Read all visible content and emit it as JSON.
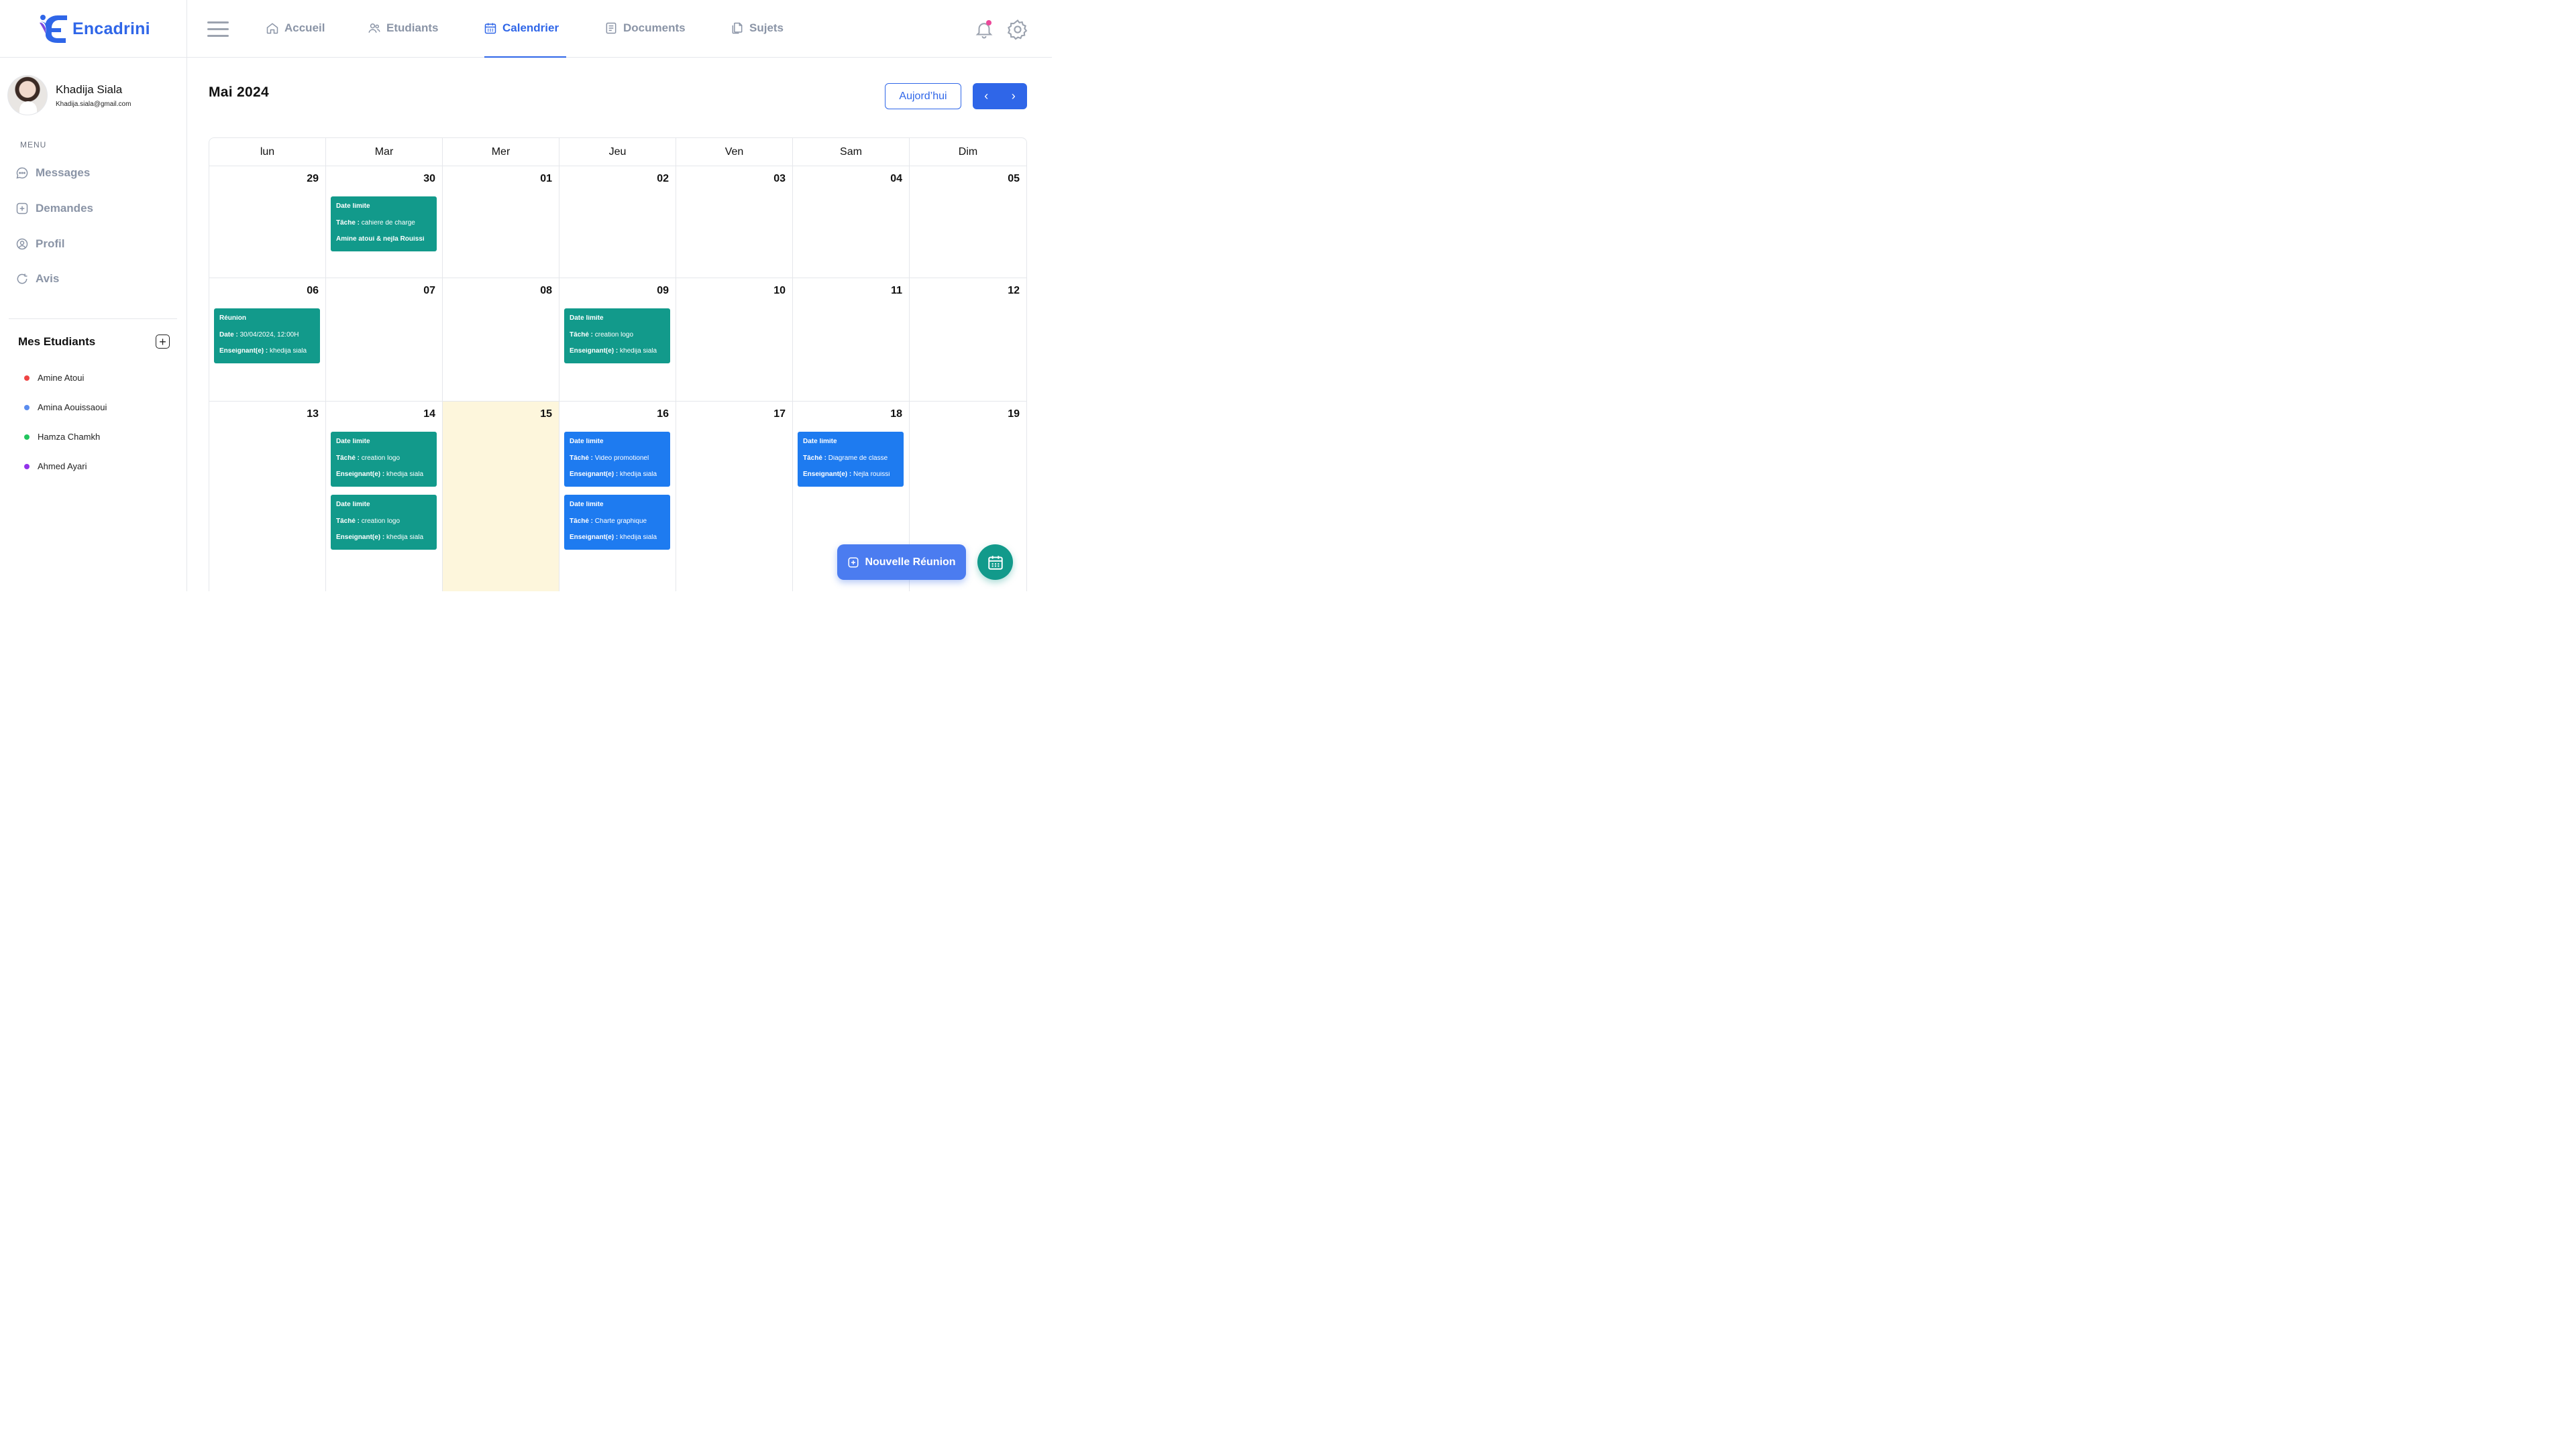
{
  "brand": {
    "name": "Encadrini",
    "color": "#2f66e8"
  },
  "user": {
    "name": "Khadija Siala",
    "email": "Khadija.siala@gmail.com"
  },
  "sidebar": {
    "menu_label": "MENU",
    "items": [
      {
        "label": "Messages",
        "icon": "chat-icon"
      },
      {
        "label": "Demandes",
        "icon": "plus-square-icon"
      },
      {
        "label": "Profil",
        "icon": "user-circle-icon"
      },
      {
        "label": "Avis",
        "icon": "refresh-icon"
      }
    ],
    "students_title": "Mes Etudiants",
    "students": [
      {
        "name": "Amine Atoui",
        "color": "#ef4444"
      },
      {
        "name": "Amina Aouissaoui",
        "color": "#5b8def"
      },
      {
        "name": "Hamza Chamkh",
        "color": "#22c55e"
      },
      {
        "name": "Ahmed Ayari",
        "color": "#9333ea"
      }
    ]
  },
  "topnav": {
    "items": [
      {
        "label": "Accueil",
        "icon": "home-icon"
      },
      {
        "label": "Etudiants",
        "icon": "users-icon"
      },
      {
        "label": "Calendrier",
        "icon": "calendar-icon",
        "active": true
      },
      {
        "label": "Documents",
        "icon": "document-icon"
      },
      {
        "label": "Sujets",
        "icon": "copy-icon"
      }
    ]
  },
  "calendar": {
    "month_title": "Mai 2024",
    "today_label": "Aujord’hui",
    "weekdays": [
      "lun",
      "Mar",
      "Mer",
      "Jeu",
      "Ven",
      "Sam",
      "Dim"
    ],
    "weeks": [
      [
        "29",
        "30",
        "01",
        "02",
        "03",
        "04",
        "05"
      ],
      [
        "06",
        "07",
        "08",
        "09",
        "10",
        "11",
        "12"
      ],
      [
        "13",
        "14",
        "15",
        "16",
        "17",
        "18",
        "19"
      ]
    ],
    "today": "15",
    "events": {
      "ev1": {
        "l1": "Date limite",
        "l2a": "Tâche :",
        "l2b": " cahiere de charge",
        "l3a": "Amine atoui & nejla Rouissi",
        "l3b": ""
      },
      "ev2": {
        "l1": "Réunion",
        "l2a": "Date :",
        "l2b": " 30/04/2024, 12:00H",
        "l3a": "Enseignant(e) :",
        "l3b": " khedija siala"
      },
      "ev3": {
        "l1": "Date limite",
        "l2a": "Tâché :",
        "l2b": " creation logo",
        "l3a": "Enseignant(e) :",
        "l3b": " khedija siala"
      },
      "ev4": {
        "l1": "Date limite",
        "l2a": "Tâché :",
        "l2b": " creation logo",
        "l3a": "Enseignant(e) :",
        "l3b": " khedija siala"
      },
      "ev5": {
        "l1": "Date limite",
        "l2a": "Tâché :",
        "l2b": " creation logo",
        "l3a": "Enseignant(e) :",
        "l3b": " khedija siala"
      },
      "ev6": {
        "l1": "Date limite",
        "l2a": "Tâché :",
        "l2b": "  Video promotionel",
        "l3a": "Enseignant(e) :",
        "l3b": " khedija siala"
      },
      "ev7": {
        "l1": "Date limite",
        "l2a": "Tâché :",
        "l2b": "  Charte graphique",
        "l3a": "Enseignant(e) :",
        "l3b": " khedija siala"
      },
      "ev8": {
        "l1": "Date limite",
        "l2a": "Tâché :",
        "l2b": "  Diagrame de classe",
        "l3a": "Enseignant(e) :",
        "l3b": " Nejla rouissi"
      }
    },
    "colors": {
      "teal": "#129a8b",
      "blue": "#1e7bf0",
      "today_bg": "#fdf6dc"
    }
  },
  "actions": {
    "new_meeting": "Nouvelle Réunion"
  }
}
